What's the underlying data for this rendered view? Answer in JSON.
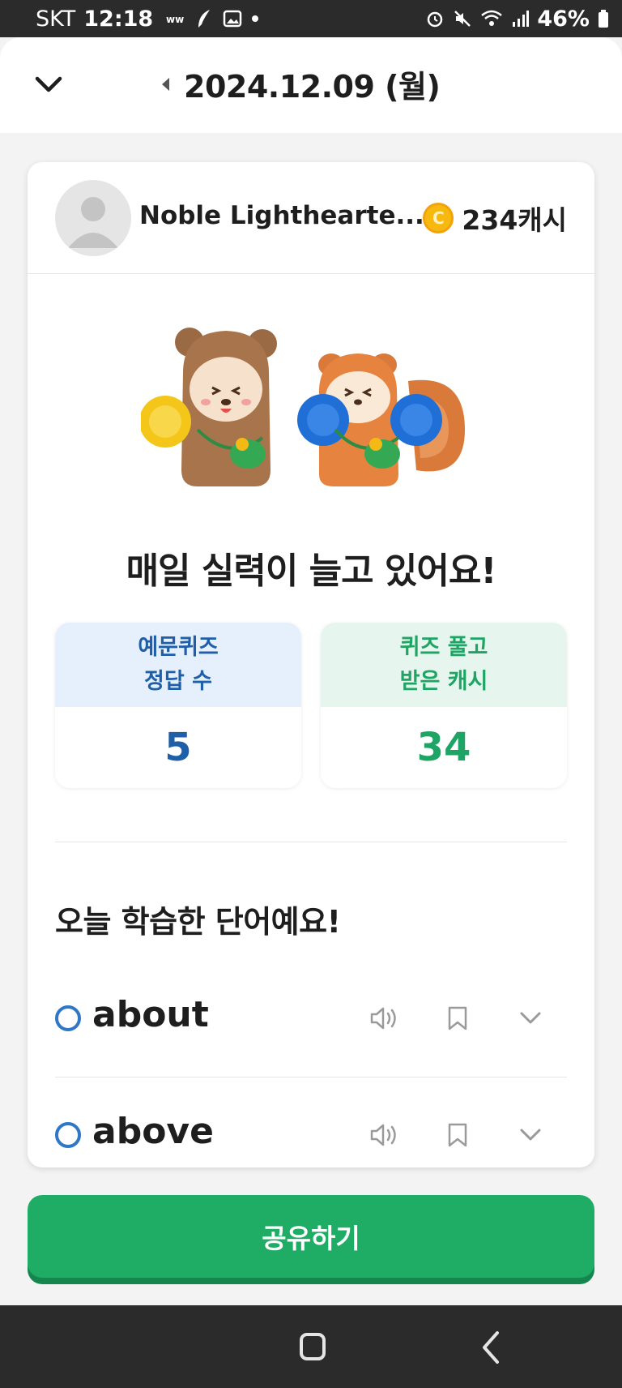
{
  "status_bar": {
    "carrier": "SKT",
    "time": "12:18",
    "battery": "46%"
  },
  "header": {
    "date": "2024.12.09 (월)"
  },
  "profile": {
    "username": "Noble Lighthearte...",
    "cash": "234캐시"
  },
  "main": {
    "headline": "매일 실력이 늘고 있어요!",
    "stats": [
      {
        "label_line1": "예문퀴즈",
        "label_line2": "정답 수",
        "value": "5"
      },
      {
        "label_line1": "퀴즈 풀고",
        "label_line2": "받은 캐시",
        "value": "34"
      }
    ],
    "section_title": "오늘 학습한 단어예요!",
    "words": [
      {
        "word": "about"
      },
      {
        "word": "above"
      }
    ]
  },
  "share_button": {
    "label": "공유하기"
  },
  "colors": {
    "accent_green": "#1fad66",
    "accent_blue": "#1f5fa8",
    "coin": "#f7b90f"
  },
  "icons": [
    "chevron-down-icon",
    "caret-left-icon",
    "user-avatar-icon",
    "coin-icon",
    "speaker-icon",
    "bookmark-icon",
    "home-icon",
    "back-icon"
  ]
}
